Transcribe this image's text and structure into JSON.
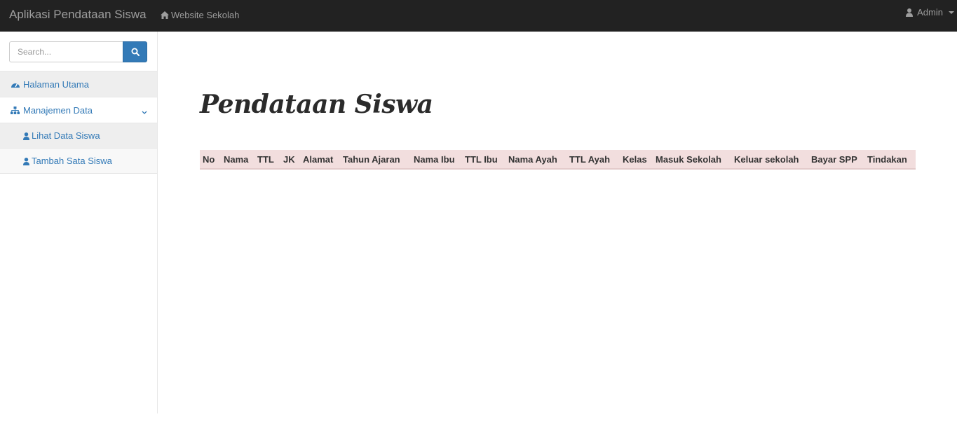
{
  "navbar": {
    "brand": "Aplikasi Pendataan Siswa",
    "website_link": "Website Sekolah",
    "user": "Admin"
  },
  "sidebar": {
    "search_placeholder": "Search...",
    "items": [
      {
        "label": "Halaman Utama",
        "icon": "dashboard-icon"
      },
      {
        "label": "Manajemen Data",
        "icon": "sitemap-icon"
      }
    ],
    "subitems": [
      {
        "label": "Lihat Data Siswa",
        "icon": "user-icon"
      },
      {
        "label": "Tambah Sata Siswa",
        "icon": "user-icon"
      }
    ]
  },
  "main": {
    "title": "Pendataan Siswa",
    "columns": [
      "No",
      "Nama",
      "TTL",
      "JK",
      "Alamat",
      "Tahun Ajaran",
      "Nama Ibu",
      "TTL Ibu",
      "Nama Ayah",
      "TTL Ayah",
      "Kelas",
      "Masuk Sekolah",
      "Keluar sekolah",
      "Bayar SPP",
      "Tindakan"
    ]
  },
  "colors": {
    "navbar_bg": "#222222",
    "link": "#337ab7",
    "table_header_bg": "#f2dede"
  }
}
